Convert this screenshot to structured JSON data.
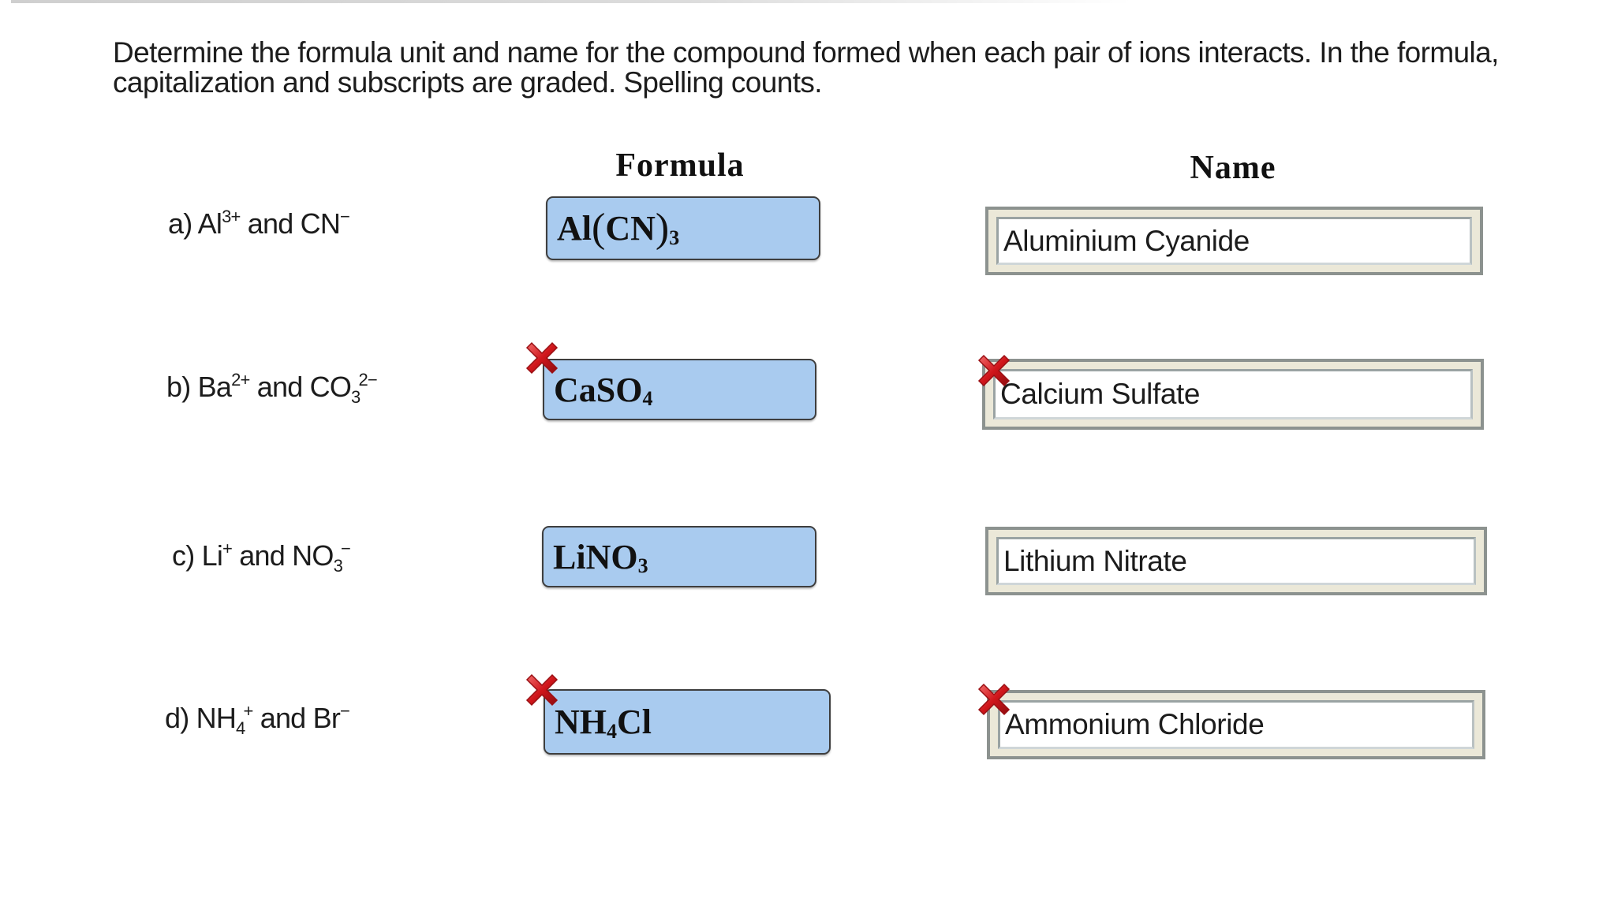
{
  "instructions": "Determine the formula unit and name for the compound formed when each pair of ions interacts. In the formula, capitalization and subscripts are graded. Spelling counts.",
  "headers": {
    "formula": "Formula",
    "name": "Name"
  },
  "rows": [
    {
      "letter": "a)",
      "cation": {
        "symbol": "Al",
        "sub": "",
        "charge": "3+"
      },
      "anion": {
        "symbol": "CN",
        "sub": "",
        "charge": "−"
      },
      "connector": "and",
      "formula": {
        "parts": [
          "Al",
          "(",
          "CN",
          ")",
          "3"
        ],
        "display": "Al(CN)3",
        "status": "unmarked"
      },
      "name": {
        "value": "Aluminium Cyanide",
        "status": "unmarked"
      }
    },
    {
      "letter": "b)",
      "cation": {
        "symbol": "Ba",
        "sub": "",
        "charge": "2+"
      },
      "anion": {
        "symbol": "CO",
        "sub": "3",
        "charge": "2−"
      },
      "connector": "and",
      "formula": {
        "parts": [
          "CaSO",
          "4"
        ],
        "display": "CaSO4",
        "status": "incorrect"
      },
      "name": {
        "value": "Calcium Sulfate",
        "status": "incorrect"
      }
    },
    {
      "letter": "c)",
      "cation": {
        "symbol": "Li",
        "sub": "",
        "charge": "+"
      },
      "anion": {
        "symbol": "NO",
        "sub": "3",
        "charge": "−"
      },
      "connector": "and",
      "formula": {
        "parts": [
          "LiNO",
          "3"
        ],
        "display": "LiNO3",
        "status": "unmarked"
      },
      "name": {
        "value": "Lithium Nitrate",
        "status": "unmarked"
      }
    },
    {
      "letter": "d)",
      "cation": {
        "symbol": "NH",
        "sub": "4",
        "charge": "+"
      },
      "anion": {
        "symbol": "Br",
        "sub": "",
        "charge": "−"
      },
      "connector": "and",
      "formula": {
        "parts": [
          "NH",
          "4",
          "Cl"
        ],
        "display": "NH4Cl",
        "status": "incorrect"
      },
      "name": {
        "value": "Ammonium Chloride",
        "status": "incorrect"
      }
    }
  ],
  "icons": {
    "incorrect": "red-x-icon"
  },
  "colors": {
    "formula_box_fill": "#a9cbef",
    "name_box_frame": "#ebe8d8",
    "incorrect_mark": "#d0161b"
  }
}
